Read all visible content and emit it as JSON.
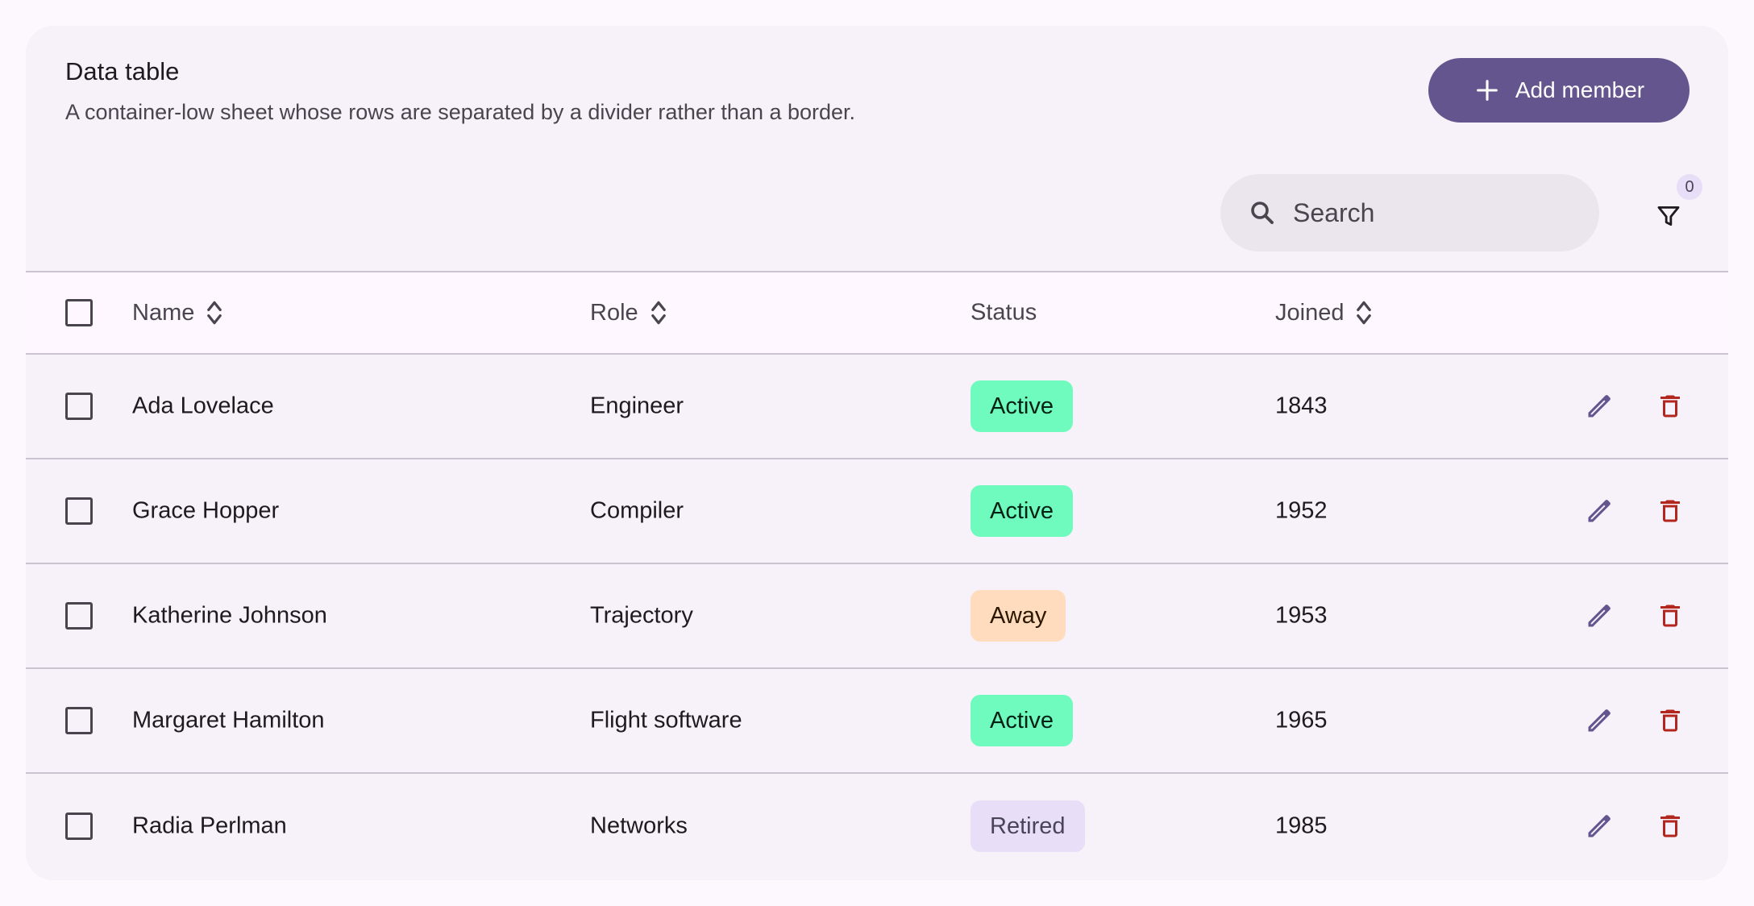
{
  "header": {
    "title": "Data table",
    "subtitle": "A container-low sheet whose rows are separated by a divider rather than a border.",
    "add_label": "Add member",
    "add_icon": "plus-icon"
  },
  "toolbar": {
    "search_placeholder": "Search",
    "search_icon": "search-icon",
    "filter_icon": "filter-icon",
    "filter_count": "0"
  },
  "columns": {
    "name": "Name",
    "role": "Role",
    "status": "Status",
    "joined": "Joined"
  },
  "rows": [
    {
      "name": "Ada Lovelace",
      "role": "Engineer",
      "status": "Active",
      "joined": "1843"
    },
    {
      "name": "Grace Hopper",
      "role": "Compiler",
      "status": "Active",
      "joined": "1952"
    },
    {
      "name": "Katherine Johnson",
      "role": "Trajectory",
      "status": "Away",
      "joined": "1953"
    },
    {
      "name": "Margaret Hamilton",
      "role": "Flight software",
      "status": "Active",
      "joined": "1965"
    },
    {
      "name": "Radia Perlman",
      "role": "Networks",
      "status": "Retired",
      "joined": "1985"
    }
  ],
  "status_colors": {
    "Active": {
      "bg": "#6ffbbe",
      "fg": "#002113"
    },
    "Away": {
      "bg": "#ffdcbe",
      "fg": "#2b1700"
    },
    "Retired": {
      "bg": "#e8def8",
      "fg": "#4a4458"
    }
  },
  "colors": {
    "primary": "#65558f",
    "error": "#b3261e",
    "surface": "#fdf7fe",
    "surface_container_low": "#f7f2f9",
    "divider": "#cac4d0"
  }
}
